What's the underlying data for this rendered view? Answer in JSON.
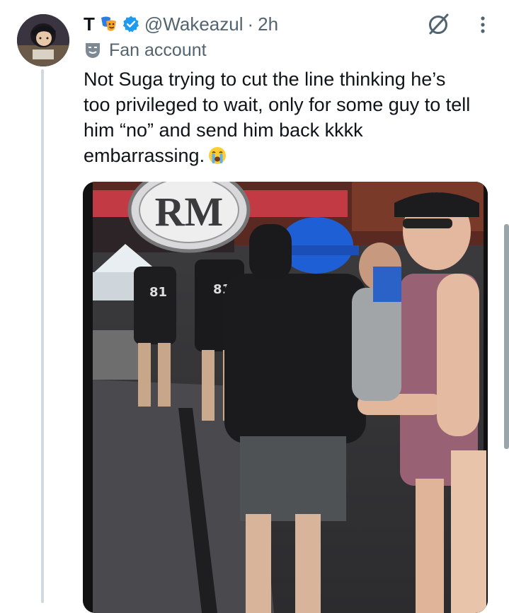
{
  "tweet": {
    "display_name": "T",
    "handle": "@Wakeazul",
    "separator": "·",
    "time": "2h",
    "account_label": "Fan account",
    "text": "Not Suga trying to cut the line thinking he’s too privileged to wait, only for some guy to tell him “no” and send back kkkk embarrassing.",
    "text_lines": [
      "Not Suga trying to cut the line thinking he’s",
      "too privileged to wait, only for some guy to tell",
      "him “no” and send him back kkkk",
      "embarrassing."
    ],
    "media_overlay_logo": "RM",
    "jersey_number": "81"
  },
  "icons": {
    "name_emoji": "theater-masks-emoji-icon",
    "verified": "verified-badge-icon",
    "grok": "grok-icon",
    "more": "more-options-icon",
    "fan_account": "theater-mask-icon",
    "cry": "loudly-crying-face-emoji-icon"
  },
  "colors": {
    "verified_blue": "#1d9bf0",
    "secondary_text": "#536471",
    "primary_text": "#0f1419",
    "thread_line": "#cfd9de"
  }
}
